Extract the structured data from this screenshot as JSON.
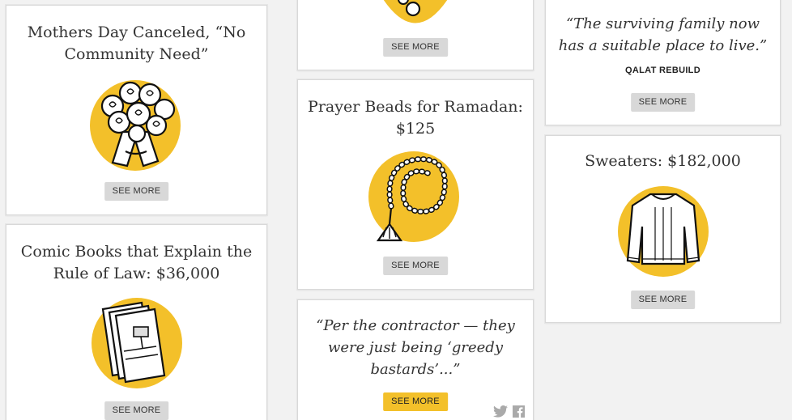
{
  "cards": {
    "mothers_day": {
      "title": "Mothers Day Canceled, “No Community Need”",
      "button": "SEE MORE",
      "icon": "bouquet-icon"
    },
    "comic_books": {
      "title": "Comic Books that Explain the Rule of Law: $36,000",
      "button": "SEE MORE",
      "icon": "comic-books-icon"
    },
    "top_middle": {
      "button": "SEE MORE",
      "icon": "partial-illustration-icon"
    },
    "prayer_beads": {
      "title": "Prayer Beads for Ramadan: $125",
      "button": "SEE MORE",
      "icon": "prayer-beads-icon"
    },
    "contractor_quote": {
      "quote": "“Per the contractor — they were just being ‘greedy bastards’...”",
      "button": "SEE MORE",
      "share_icons": [
        "twitter-icon",
        "facebook-icon"
      ]
    },
    "family_quote": {
      "quote": "“The surviving family now has a suitable place to live.”",
      "attribution": "QALAT REBUILD",
      "button": "SEE MORE"
    },
    "sweaters": {
      "title": "Sweaters: $182,000",
      "button": "SEE MORE",
      "icon": "sweater-icon"
    }
  },
  "colors": {
    "accent_yellow": "#f3c02a",
    "button_gray": "#d8d8d8",
    "text": "#333333"
  }
}
